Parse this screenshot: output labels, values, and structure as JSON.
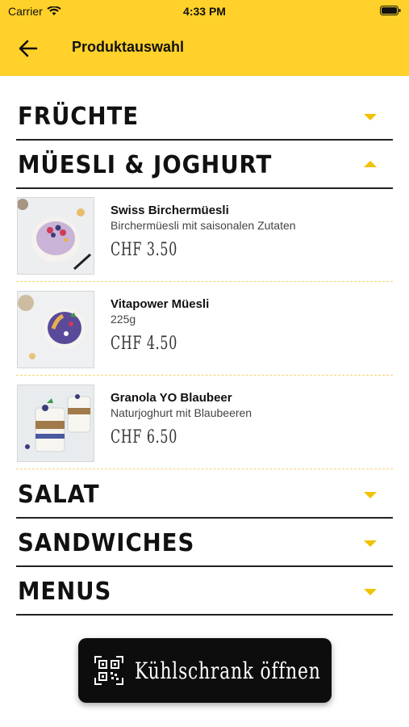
{
  "status_bar": {
    "carrier": "Carrier",
    "time": "4:33 PM"
  },
  "header": {
    "title": "Produktauswahl"
  },
  "categories": [
    {
      "label": "FRÜCHTE",
      "expanded": false
    },
    {
      "label": "MÜESLI & JOGHURT",
      "expanded": true
    },
    {
      "label": "SALAT",
      "expanded": false
    },
    {
      "label": "SANDWICHES",
      "expanded": false
    },
    {
      "label": "MENUS",
      "expanded": false
    }
  ],
  "products": [
    {
      "name": "Swiss Birchermüesli",
      "description": "Birchermüesli mit saisonalen Zutaten",
      "price": "CHF 3.50"
    },
    {
      "name": "Vitapower Müesli",
      "description": "225g",
      "price": "CHF 4.50"
    },
    {
      "name": "Granola YO Blaubeer",
      "description": "Naturjoghurt mit Blaubeeren",
      "price": "CHF 6.50"
    }
  ],
  "open_button": {
    "label": "Kühlschrank öffnen",
    "icon": "qr-code-icon"
  },
  "colors": {
    "accent": "#FFD12A",
    "caret": "#F1C200",
    "button": "#0D0D0D"
  }
}
